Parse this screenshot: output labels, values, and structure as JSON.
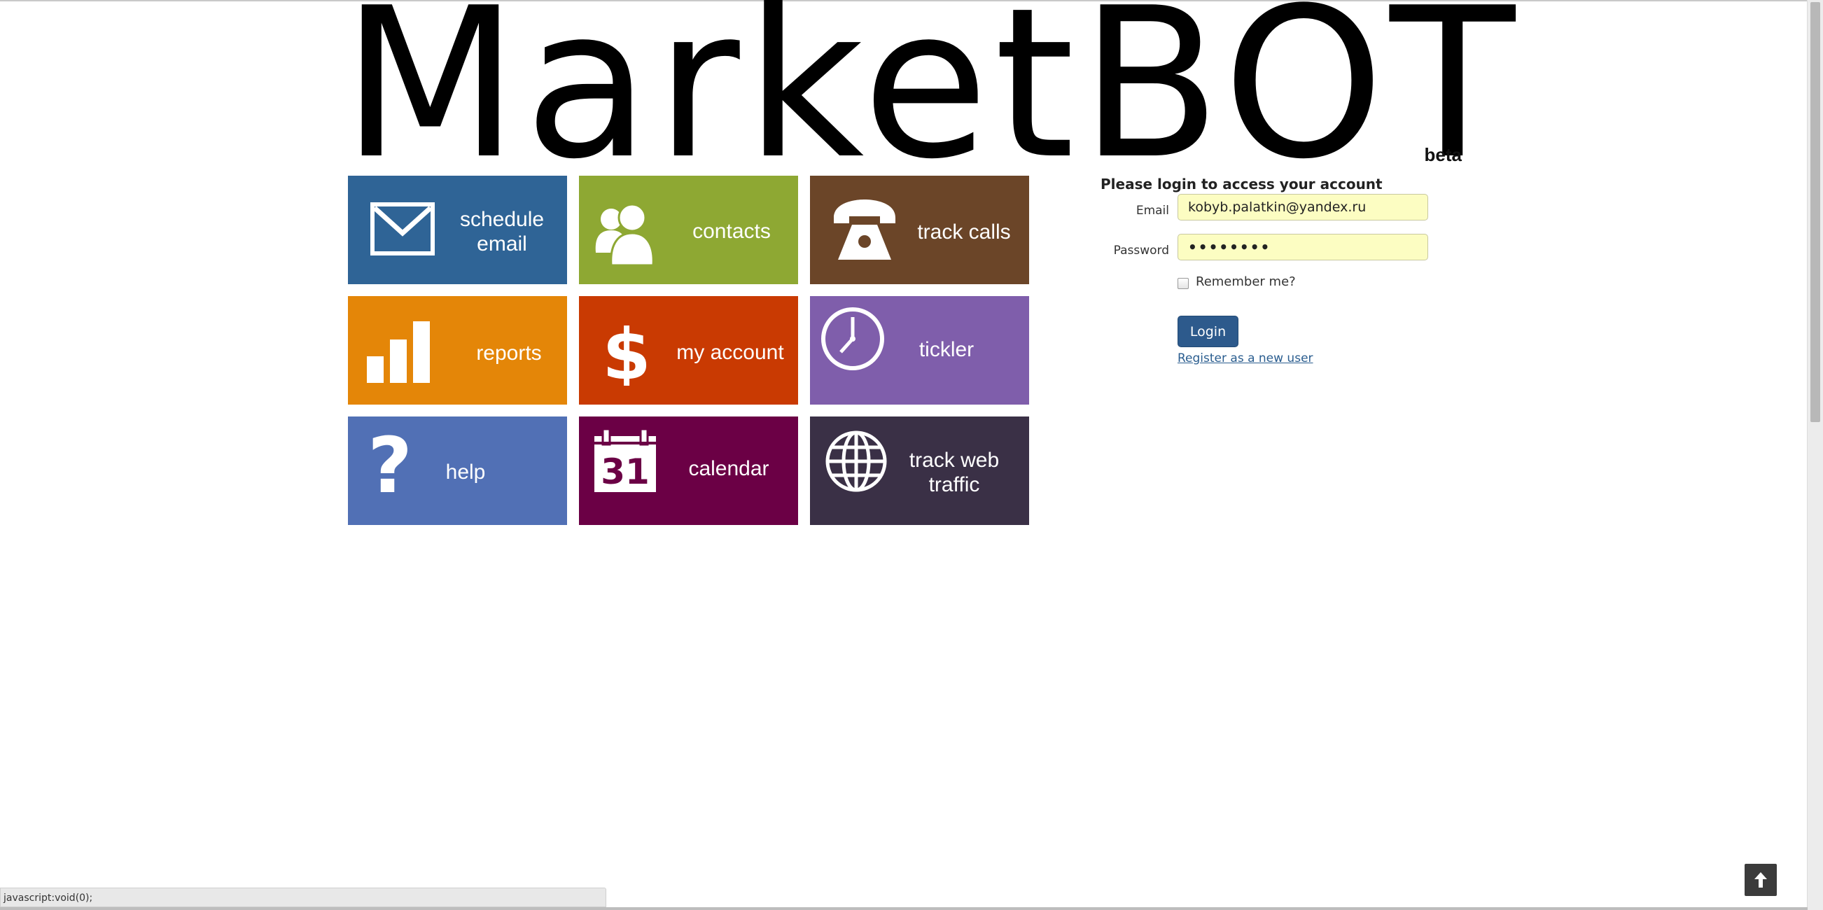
{
  "brand": {
    "logo_text": "MarketBOT",
    "badge": "beta"
  },
  "tiles": [
    {
      "label_line1": "schedule",
      "label_line2": "email",
      "icon": "envelope-icon",
      "color": "#2f6496"
    },
    {
      "label_line1": "contacts",
      "label_line2": "",
      "icon": "contacts-icon",
      "color": "#8ea833"
    },
    {
      "label_line1": "track calls",
      "label_line2": "",
      "icon": "telephone-icon",
      "color": "#6b4528"
    },
    {
      "label_line1": "reports",
      "label_line2": "",
      "icon": "bar-chart-icon",
      "color": "#e48608"
    },
    {
      "label_line1": "my account",
      "label_line2": "",
      "icon": "dollar-icon",
      "color": "#c93a02"
    },
    {
      "label_line1": "tickler",
      "label_line2": "",
      "icon": "clock-icon",
      "color": "#7f5eab"
    },
    {
      "label_line1": "help",
      "label_line2": "",
      "icon": "question-icon",
      "color": "#5170b5"
    },
    {
      "label_line1": "calendar",
      "label_line2": "",
      "icon": "calendar-icon",
      "color": "#6b0045"
    },
    {
      "label_line1": "track web",
      "label_line2": "traffic",
      "icon": "globe-icon",
      "color": "#3a3046"
    }
  ],
  "login": {
    "title": "Please login to access your account",
    "email_label": "Email",
    "email_value": "kobyb.palatkin@yandex.ru",
    "password_label": "Password",
    "password_value": "••••••••",
    "remember_label": "Remember me?",
    "login_button": "Login",
    "register_link": "Register as a new user"
  },
  "status_bar": {
    "text": "javascript:void(0);"
  }
}
